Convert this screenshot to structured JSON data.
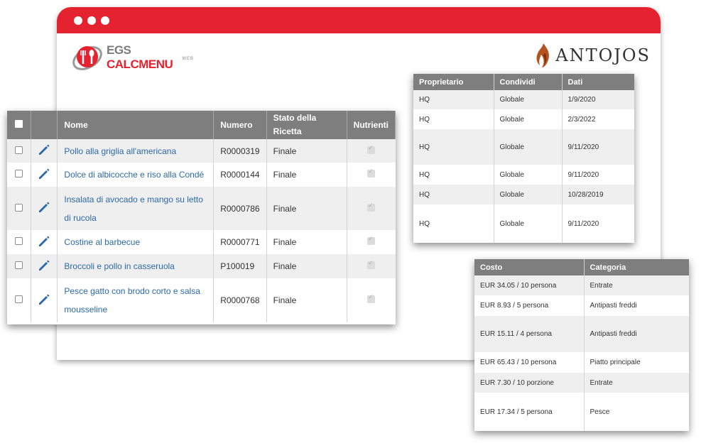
{
  "logos": {
    "egs_part1": "EGS ",
    "egs_part2": "CALCMENU",
    "egs_sub": "WEB",
    "antojos": "ANTOJOS"
  },
  "colors": {
    "brand_red": "#e52330",
    "header_gray": "#7e7e7e",
    "link_blue": "#2b6aa8"
  },
  "recipes": {
    "headers": {
      "name": "Nome",
      "number": "Numero",
      "status": "Stato della Ricetta",
      "nutrients": "Nutrienti"
    },
    "rows": [
      {
        "name": "Pollo alla griglia all'americana",
        "number": "R0000319",
        "status": "Finale"
      },
      {
        "name": "Dolce di albicocche e riso alla Condé",
        "number": "R0000144",
        "status": "Finale"
      },
      {
        "name": "Insalata di avocado e mango su letto di rucola",
        "number": "R0000786",
        "status": "Finale"
      },
      {
        "name": "Costine al barbecue",
        "number": "R0000771",
        "status": "Finale"
      },
      {
        "name": "Broccoli e pollo in casseruola",
        "number": "P100019",
        "status": "Finale"
      },
      {
        "name": "Pesce gatto con brodo corto e salsa mousseline",
        "number": "R0000768",
        "status": "Finale"
      }
    ]
  },
  "owners": {
    "headers": {
      "owner": "Proprietario",
      "share": "Condividi",
      "date": "Dati"
    },
    "rows": [
      {
        "owner": "HQ",
        "share": "Globale",
        "date": "1/9/2020"
      },
      {
        "owner": "HQ",
        "share": "Globale",
        "date": "2/3/2022"
      },
      {
        "owner": "HQ",
        "share": "Globale",
        "date": "9/11/2020"
      },
      {
        "owner": "HQ",
        "share": "Globale",
        "date": "9/11/2020"
      },
      {
        "owner": "HQ",
        "share": "Globale",
        "date": "10/28/2019"
      },
      {
        "owner": "HQ",
        "share": "Globale",
        "date": "9/11/2020"
      }
    ]
  },
  "costs": {
    "headers": {
      "cost": "Costo",
      "category": "Categoria"
    },
    "rows": [
      {
        "cost": "EUR 34.05 / 10 persona",
        "category": "Entrate"
      },
      {
        "cost": "EUR 8.93 / 5 persona",
        "category": "Antipasti freddi"
      },
      {
        "cost": "EUR 15.11 / 4 persona",
        "category": "Antipasti freddi"
      },
      {
        "cost": "EUR 65.43 / 10 persona",
        "category": "Piatto principale"
      },
      {
        "cost": "EUR 7.30 / 10 porzione",
        "category": "Entrate"
      },
      {
        "cost": "EUR 17.34 / 5 persona",
        "category": "Pesce"
      }
    ]
  }
}
